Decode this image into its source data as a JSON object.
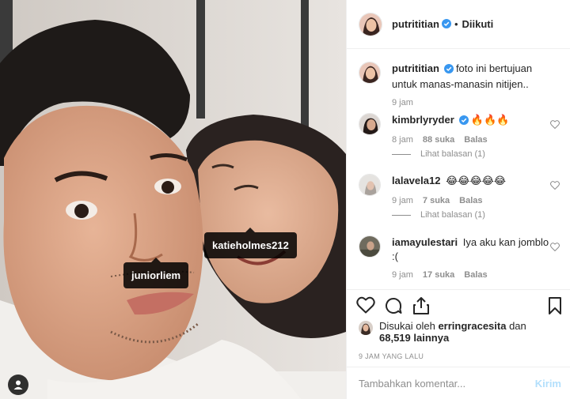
{
  "post": {
    "author": "putrititian",
    "follow_status": "Diikuti",
    "separator": "•",
    "user_tags": [
      "katieholmes212",
      "juniorliem"
    ]
  },
  "comments": [
    {
      "user": "putrititian",
      "verified": true,
      "text": "foto ini bertujuan untuk manas-manasin nitijen..",
      "time": "9 jam"
    },
    {
      "user": "kimbrlyryder",
      "verified": true,
      "text": "🔥🔥🔥",
      "time": "8 jam",
      "likes": "88 suka",
      "reply": "Balas",
      "view_replies": "Lihat balasan (1)"
    },
    {
      "user": "lalavela12",
      "verified": false,
      "text": "😂😂😂😂😂",
      "time": "9 jam",
      "likes": "7 suka",
      "reply": "Balas",
      "view_replies": "Lihat balasan (1)"
    },
    {
      "user": "iamayulestari",
      "verified": false,
      "text": "Iya aku kan jomblo :(",
      "time": "9 jam",
      "likes": "17 suka",
      "reply": "Balas"
    }
  ],
  "likes": {
    "prefix": "Disukai oleh",
    "user": "erringracesita",
    "connector": "dan",
    "others": "68,519 lainnya"
  },
  "time_ago": "9 JAM YANG LALU",
  "add_comment": {
    "placeholder": "Tambahkan komentar...",
    "post_label": "Kirim"
  },
  "colors": {
    "verified_blue": "#3897f0",
    "muted_text": "#8e8e8e",
    "post_button": "#b2dffc"
  },
  "icons": [
    "heart-icon",
    "comment-icon",
    "share-icon",
    "bookmark-icon",
    "user-tag-icon",
    "verified-badge-icon"
  ]
}
